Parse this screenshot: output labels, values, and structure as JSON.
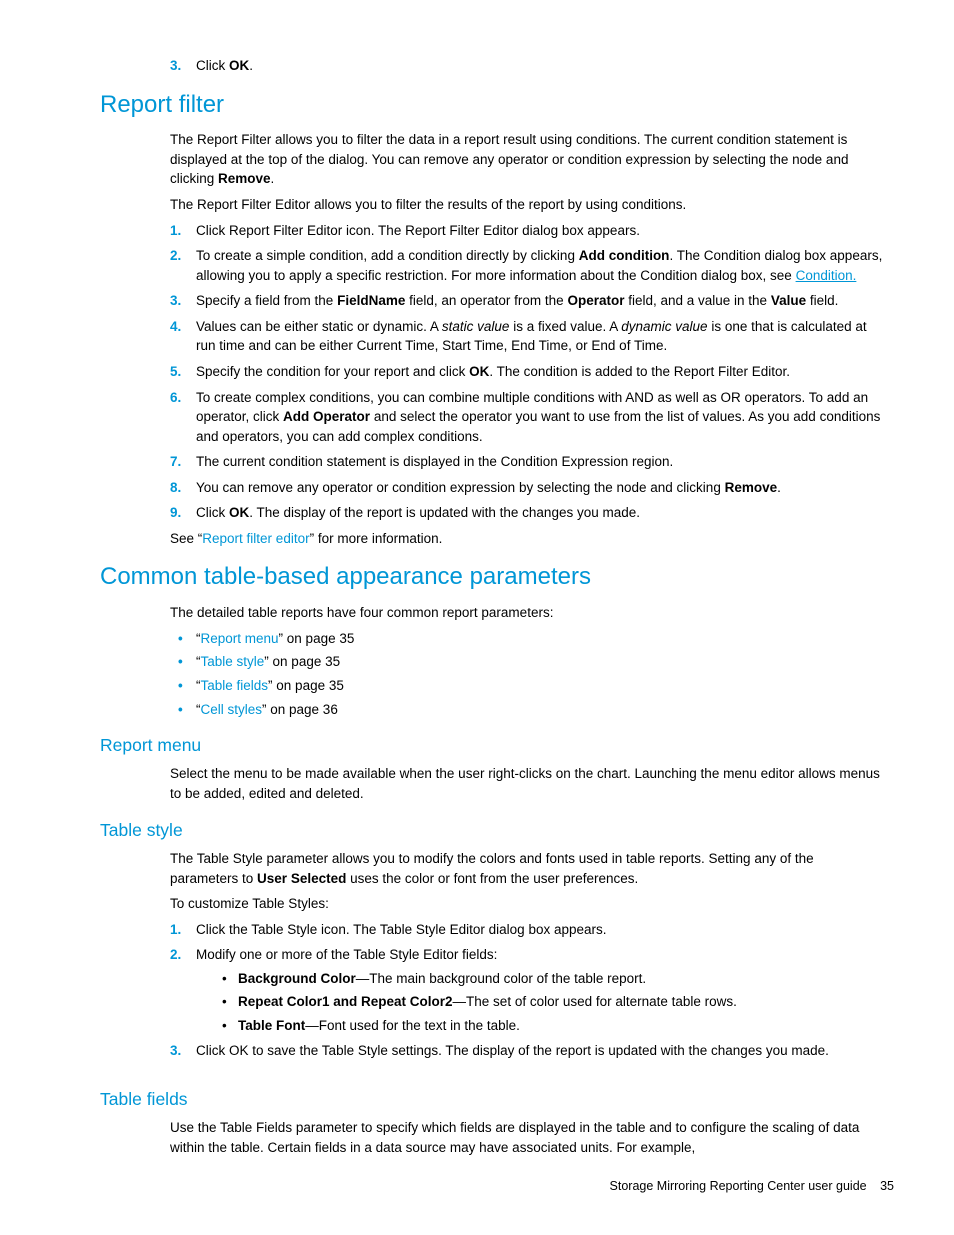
{
  "top_ol": {
    "item3": {
      "marker": "3.",
      "pre": "Click ",
      "bold": "OK",
      "post": "."
    }
  },
  "report_filter": {
    "heading": "Report filter",
    "p1_a": "The Report Filter allows you to filter the data in a report result using conditions. The current condition statement is displayed at the top of the dialog. You can remove any operator or condition expression by selecting the node and clicking ",
    "p1_bold": "Remove",
    "p1_b": ".",
    "p2": "The Report Filter Editor allows you to filter the results of the report by using conditions.",
    "steps": {
      "s1": {
        "marker": "1.",
        "text": "Click Report Filter Editor icon. The Report Filter Editor dialog box appears."
      },
      "s2": {
        "marker": "2.",
        "a": "To create a simple condition, add a condition directly by clicking ",
        "b1": "Add condition",
        "b": ". The Condition dialog box appears, allowing you to apply a specific restriction. For more information about the Condition dialog box, see ",
        "link": "Condition."
      },
      "s3": {
        "marker": "3.",
        "a": "Specify a field from the ",
        "b1": "FieldName",
        "b": " field, an operator from the ",
        "b2": "Operator",
        "c": " field, and a value in the ",
        "b3": "Value",
        "d": " field."
      },
      "s4": {
        "marker": "4.",
        "a": "Values can be either static or dynamic. A ",
        "i1": "static value",
        "b": " is a fixed value. A ",
        "i2": "dynamic value",
        "c": " is one that is calculated at run time and can be either Current Time, Start Time, End Time, or End of Time."
      },
      "s5": {
        "marker": "5.",
        "a": "Specify the condition for your report and click ",
        "b1": "OK",
        "b": ". The condition is added to the Report Filter Editor."
      },
      "s6": {
        "marker": "6.",
        "a": "To create complex conditions, you can combine multiple conditions with AND as well as OR operators. To add an operator, click ",
        "b1": "Add Operator",
        "b": " and select the operator you want to use from the list of values. As you add conditions and operators, you can add complex conditions."
      },
      "s7": {
        "marker": "7.",
        "text": "The current condition statement is displayed in the Condition Expression region."
      },
      "s8": {
        "marker": "8.",
        "a": "You can remove any operator or condition expression by selecting the node and clicking ",
        "b1": "Remove",
        "b": "."
      },
      "s9": {
        "marker": "9.",
        "a": "Click ",
        "b1": "OK",
        "b": ". The display of the report is updated with the changes you made."
      }
    },
    "p3_a": "See “",
    "p3_link": "Report filter editor",
    "p3_b": "” for more information."
  },
  "common": {
    "heading": "Common table-based appearance parameters",
    "p1": "The detailed table reports have four common report parameters:",
    "items": {
      "i1": {
        "q1": "“",
        "link": "Report menu",
        "q2": "” on page 35"
      },
      "i2": {
        "q1": "“",
        "link": "Table style",
        "q2": "” on page 35"
      },
      "i3": {
        "q1": "“",
        "link": "Table fields",
        "q2": "” on page 35"
      },
      "i4": {
        "q1": "“",
        "link": "Cell styles",
        "q2": "” on page 36"
      }
    }
  },
  "report_menu": {
    "heading": "Report menu",
    "p1": "Select the menu to be made available when the user right-clicks on the chart. Launching the menu editor allows menus to be added, edited and deleted."
  },
  "table_style": {
    "heading": "Table style",
    "p1_a": "The Table Style parameter allows you to modify the colors and fonts used in table reports. Setting any of the parameters to ",
    "p1_bold": "User Selected",
    "p1_b": " uses the color or font from the user preferences.",
    "p2": "To customize Table Styles:",
    "steps": {
      "s1": {
        "marker": "1.",
        "text": "Click the Table Style icon. The Table Style Editor dialog box appears."
      },
      "s2": {
        "marker": "2.",
        "text": "Modify one or more of the Table Style Editor fields:",
        "sub": {
          "a": {
            "b": "Background Color",
            "t": "—The main background color of the table report."
          },
          "b": {
            "b": "Repeat Color1 and Repeat Color2",
            "t": "—The set of color used for alternate table rows."
          },
          "c": {
            "b": "Table Font",
            "t": "—Font used for the text in the table."
          }
        }
      },
      "s3": {
        "marker": "3.",
        "text": "Click OK to save the Table Style settings. The display of the report is updated with the changes you made."
      }
    }
  },
  "table_fields": {
    "heading": "Table fields",
    "p1": "Use the Table Fields parameter to specify which fields are displayed in the table and to configure the scaling of data within the table. Certain fields in a data source may have associated units. For example,"
  },
  "footer": {
    "title": "Storage Mirroring Reporting Center user guide",
    "page": "35"
  }
}
